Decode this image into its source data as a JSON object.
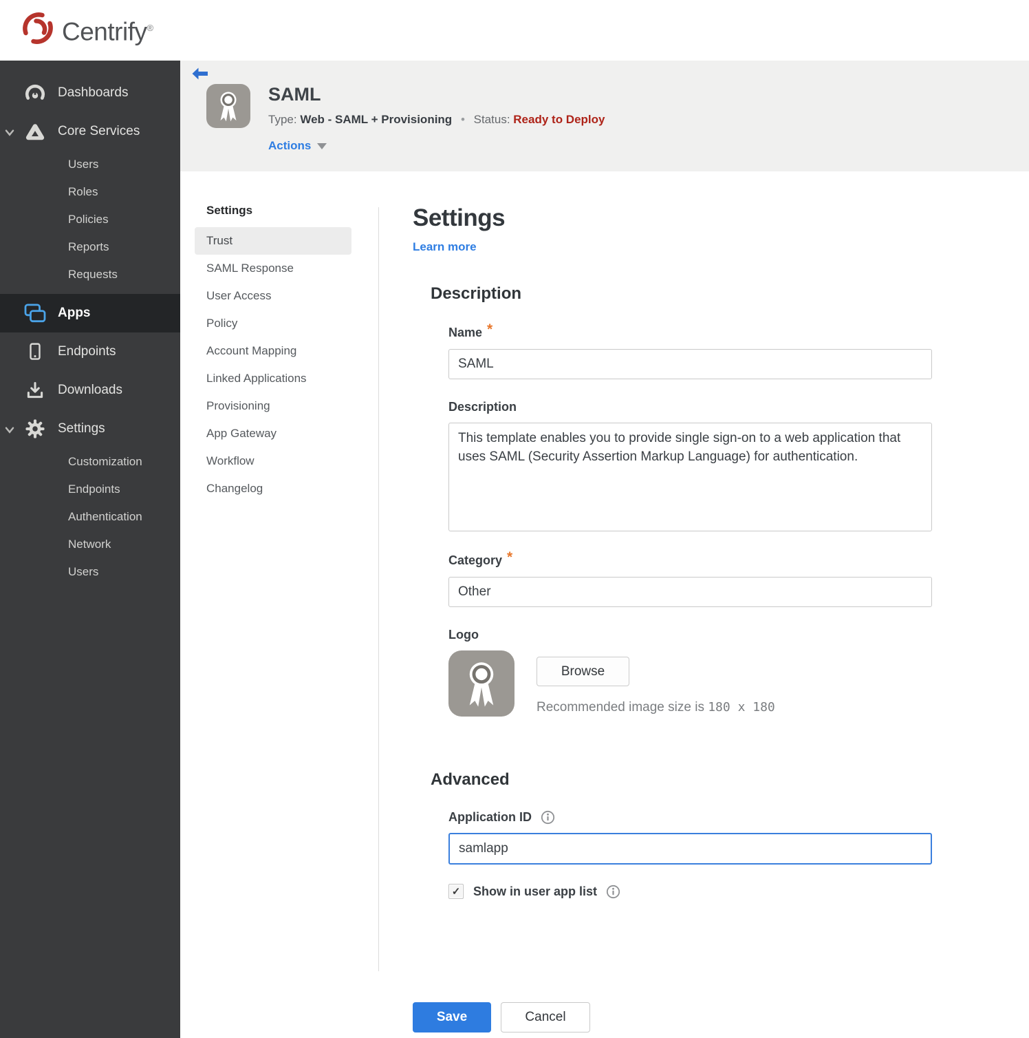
{
  "brand": {
    "name": "Centrify",
    "trademark": "®"
  },
  "sidebar": {
    "items": [
      {
        "label": "Dashboards"
      },
      {
        "label": "Core Services",
        "expanded": true,
        "children": [
          "Users",
          "Roles",
          "Policies",
          "Reports",
          "Requests"
        ]
      },
      {
        "label": "Apps",
        "active": true
      },
      {
        "label": "Endpoints"
      },
      {
        "label": "Downloads"
      },
      {
        "label": "Settings",
        "expanded": true,
        "children": [
          "Customization",
          "Endpoints",
          "Authentication",
          "Network",
          "Users"
        ]
      }
    ]
  },
  "header": {
    "title": "SAML",
    "type_label": "Type:",
    "type_value": "Web - SAML + Provisioning",
    "separator": "•",
    "status_label": "Status:",
    "status_value": "Ready to Deploy",
    "actions_label": "Actions"
  },
  "subnav": {
    "header": "Settings",
    "active_item": "Trust",
    "items": [
      "Trust",
      "SAML Response",
      "User Access",
      "Policy",
      "Account Mapping",
      "Linked Applications",
      "Provisioning",
      "App Gateway",
      "Workflow",
      "Changelog"
    ]
  },
  "main": {
    "title": "Settings",
    "learn_more": "Learn more",
    "description_section": {
      "heading": "Description",
      "name_label": "Name",
      "name_required": "*",
      "name_value": "SAML",
      "description_label": "Description",
      "description_value": "This template enables you to provide single sign-on to a web application that uses SAML (Security Assertion Markup Language) for authentication.",
      "category_label": "Category",
      "category_required": "*",
      "category_value": "Other",
      "logo_label": "Logo",
      "browse_label": "Browse",
      "recommended_prefix": "Recommended image size is ",
      "recommended_size": "180 x 180"
    },
    "advanced_section": {
      "heading": "Advanced",
      "application_id_label": "Application ID",
      "application_id_value": "samlapp",
      "show_in_app_list_label": "Show in user app list",
      "checkbox_checked": true
    },
    "footer": {
      "save_label": "Save",
      "cancel_label": "Cancel"
    }
  },
  "ui": {
    "check_glyph": "✓"
  },
  "colors": {
    "brand_red": "#b6342c",
    "sidebar_bg": "#3a3b3d",
    "sidebar_active_bg": "#232527",
    "apps_icon_blue": "#4aa3e8",
    "header_band": "#f0f0ef",
    "link_blue": "#2e7de2",
    "save_blue": "#2e7ce0",
    "status_red": "#ae2318",
    "required_orange": "#e8782d",
    "focused_input_blue": "#3a7fdd"
  }
}
